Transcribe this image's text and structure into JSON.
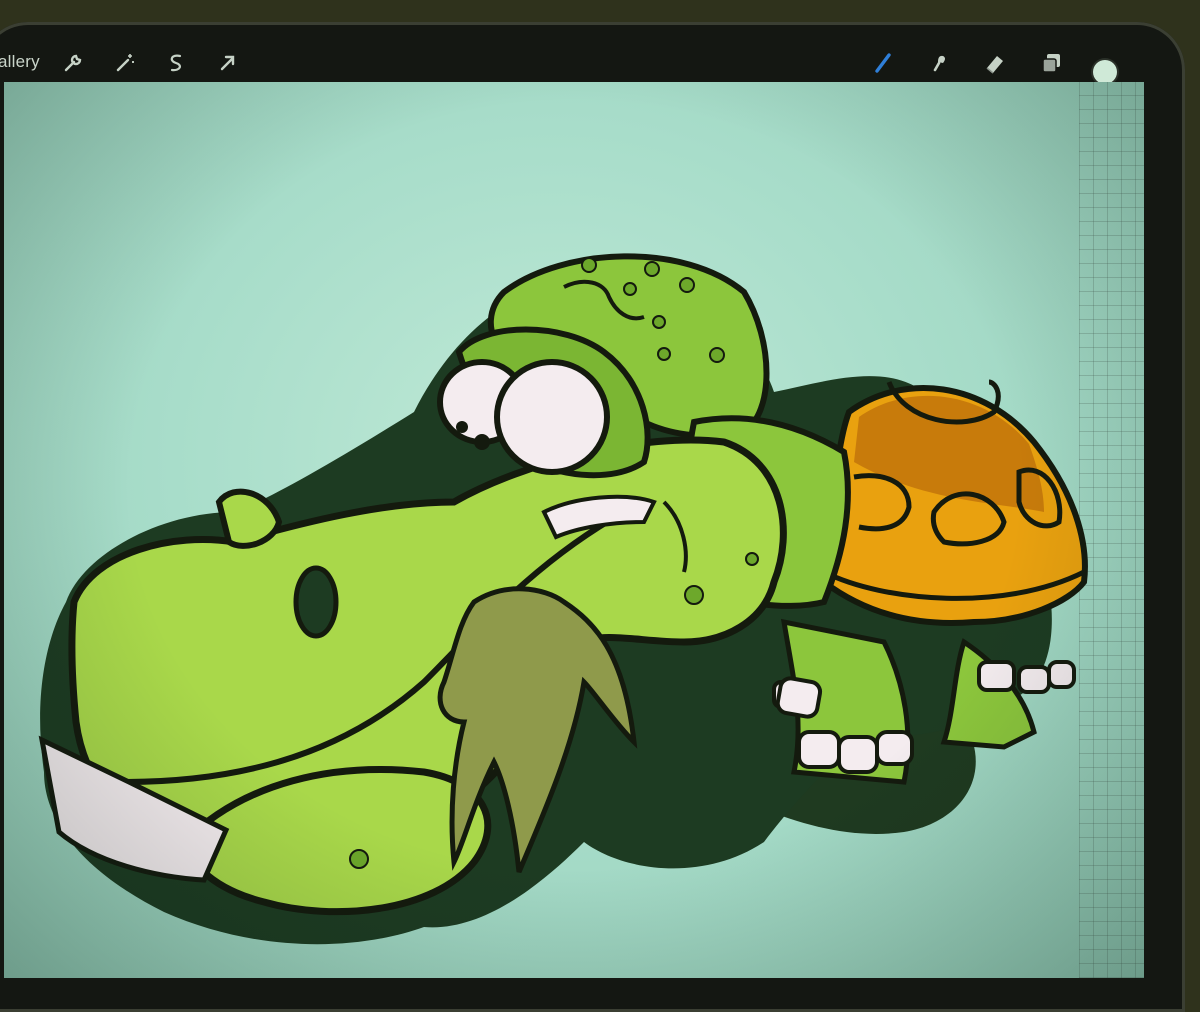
{
  "app": {
    "gallery_label": "allery"
  },
  "toolbar": {
    "left_tools": [
      "wrench-icon",
      "magic-wand-icon",
      "selection-icon",
      "transform-arrow-icon"
    ],
    "right_tools": [
      "brush-icon",
      "smudge-icon",
      "eraser-icon",
      "layers-icon"
    ]
  },
  "colors": {
    "active_brush": "#2f7fd8",
    "current_color": "#cfe9d7",
    "canvas_bg": "#a8ddca",
    "skin_light": "#a9d84a",
    "skin_mid": "#8cc63c",
    "shell_orange": "#e9a10f",
    "shell_dark": "#c87b0b",
    "shadow": "#1d3b22",
    "beard": "#8f9a4b",
    "outline": "#141a0e"
  }
}
